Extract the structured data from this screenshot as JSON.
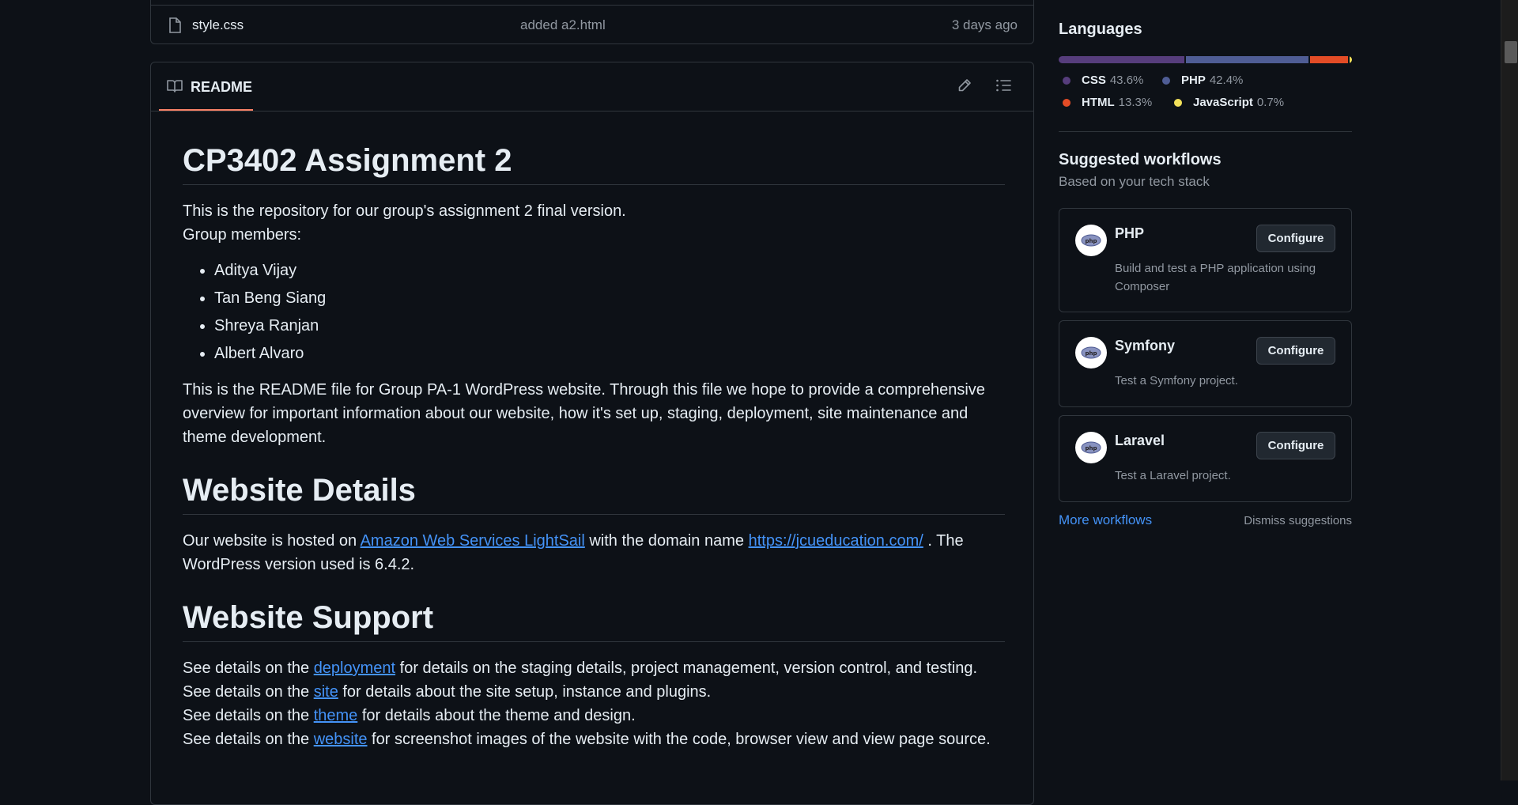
{
  "file_row": {
    "name": "style.css",
    "message": "added a2.html",
    "date": "3 days ago"
  },
  "readme": {
    "tab_label": "README",
    "title": "CP3402 Assignment 2",
    "intro_line1": "This is the repository for our group's assignment 2 final version.",
    "intro_line2": "Group members:",
    "members": [
      "Aditya Vijay",
      "Tan Beng Siang",
      "Shreya Ranjan",
      "Albert Alvaro"
    ],
    "overview": "This is the README file for Group PA-1 WordPress website. Through this file we hope to provide a comprehensive overview for important information about our website, how it's set up, staging, deployment, site maintenance and theme development.",
    "details_heading": "Website Details",
    "details_text_a": "Our website is hosted on ",
    "details_link1": "Amazon Web Services LightSail",
    "details_text_b": " with the domain name ",
    "details_link2": "https://jcueducation.com/",
    "details_text_c": " . The WordPress version used is 6.4.2.",
    "support_heading": "Website Support",
    "support_lines": [
      {
        "pre": "See details on the ",
        "link": "deployment",
        "post": " for details on the staging details, project management, version control, and testing."
      },
      {
        "pre": "See details on the ",
        "link": "site",
        "post": " for details about the site setup, instance and plugins."
      },
      {
        "pre": "See details on the ",
        "link": "theme",
        "post": " for details about the theme and design."
      },
      {
        "pre": "See details on the ",
        "link": "website",
        "post": " for screenshot images of the website with the code, browser view and view page source."
      }
    ]
  },
  "languages": {
    "heading": "Languages",
    "items": [
      {
        "name": "CSS",
        "percent": "43.6%",
        "value": 43.6,
        "color": "#563d7c"
      },
      {
        "name": "PHP",
        "percent": "42.4%",
        "value": 42.4,
        "color": "#4f5d95"
      },
      {
        "name": "HTML",
        "percent": "13.3%",
        "value": 13.3,
        "color": "#e34c26"
      },
      {
        "name": "JavaScript",
        "percent": "0.7%",
        "value": 0.7,
        "color": "#f1e05a"
      }
    ]
  },
  "workflows": {
    "heading": "Suggested workflows",
    "subheading": "Based on your tech stack",
    "items": [
      {
        "name": "PHP",
        "desc": "Build and test a PHP application using Composer",
        "button": "Configure"
      },
      {
        "name": "Symfony",
        "desc": "Test a Symfony project.",
        "button": "Configure"
      },
      {
        "name": "Laravel",
        "desc": "Test a Laravel project.",
        "button": "Configure"
      }
    ],
    "more_link": "More workflows",
    "dismiss_link": "Dismiss suggestions"
  },
  "icons": {
    "file": "file-icon",
    "book": "book-icon",
    "edit": "pencil-icon",
    "outline": "list-icon",
    "php_logo": "php-logo-icon"
  },
  "colors": {
    "accent_link": "#4493f8",
    "tab_underline": "#f78166"
  }
}
